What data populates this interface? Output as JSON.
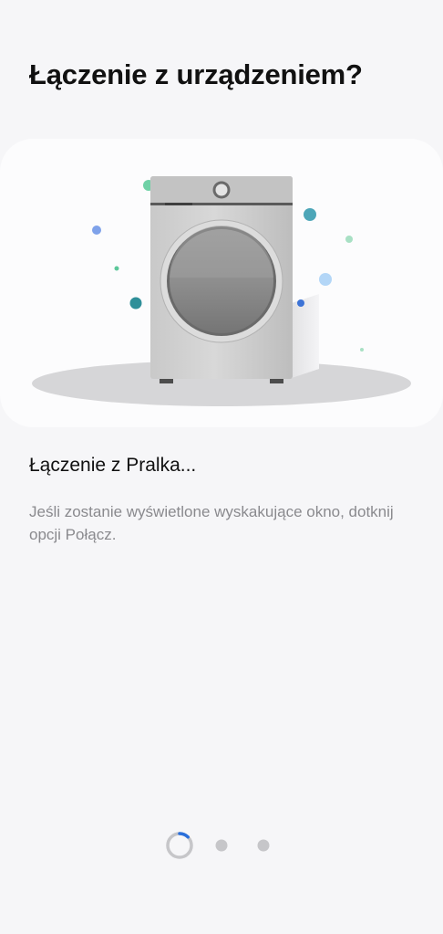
{
  "header": {
    "title": "Łączenie z urządzeniem?"
  },
  "illustration": {
    "device_icon": "washing-machine-icon",
    "accent_color": "#3e9cb2"
  },
  "status": {
    "title": "Łączenie z Pralka...",
    "hint": "Jeśli zostanie wyświetlone wyskakujące okno, dotknij opcji Połącz."
  },
  "pager": {
    "step_count": 3,
    "active_step": 1,
    "spinner_color": "#2a6fdb"
  }
}
